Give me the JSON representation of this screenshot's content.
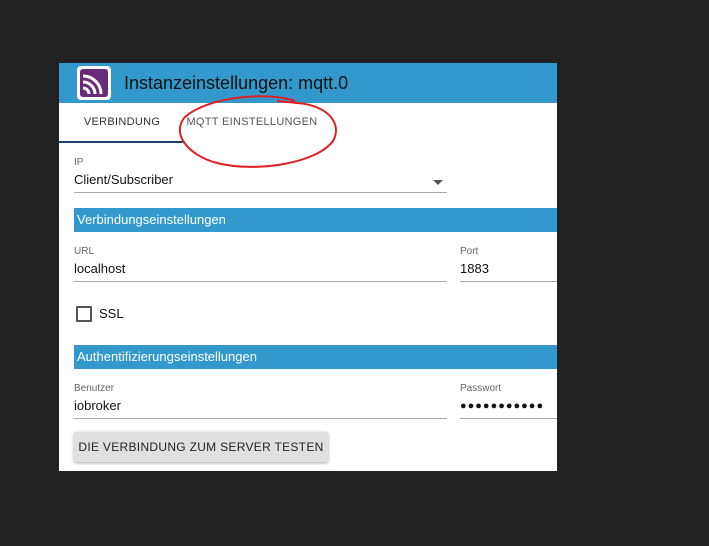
{
  "header": {
    "title": "Instanzeinstellungen: mqtt.0",
    "logo_icon": "wifi-signal-icon"
  },
  "tabs": [
    {
      "label": "VERBINDUNG",
      "active": true
    },
    {
      "label": "MQTT EINSTELLUNGEN",
      "active": false
    }
  ],
  "ip_field": {
    "label": "IP",
    "value": "Client/Subscriber"
  },
  "sections": {
    "connection": "Verbindungseinstellungen",
    "auth": "Authentifizierungseinstellungen"
  },
  "url_field": {
    "label": "URL",
    "value": "localhost"
  },
  "port_field": {
    "label": "Port",
    "value": "1883"
  },
  "ssl": {
    "label": "SSL",
    "checked": false
  },
  "user_field": {
    "label": "Benutzer",
    "value": "iobroker"
  },
  "password_field": {
    "label": "Passwort",
    "value": "●●●●●●●●●●●"
  },
  "test_button": {
    "label": "DIE VERBINDUNG ZUM SERVER TESTEN"
  },
  "colors": {
    "header": "#3399cc",
    "section": "#3399cc",
    "annotation": "#e02020",
    "background": "#222222"
  }
}
